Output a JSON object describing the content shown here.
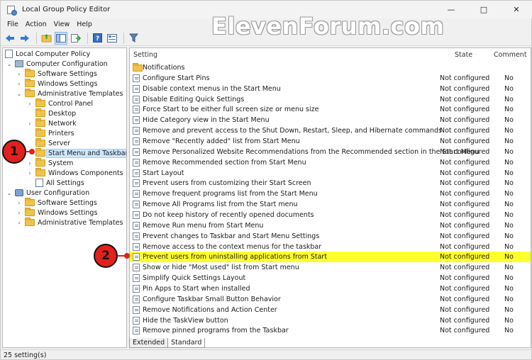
{
  "window": {
    "title": "Local Group Policy Editor",
    "controls": {
      "minimize": "—",
      "maximize": "□",
      "close": "✕"
    }
  },
  "watermark": "ElevenForum.com",
  "menu": {
    "file": "File",
    "action": "Action",
    "view": "View",
    "help": "Help"
  },
  "toolbar": {
    "icons": [
      "back-arrow-icon",
      "forward-arrow-icon",
      "folder-up-icon",
      "show-hide-tree-icon",
      "export-list-icon",
      "help-icon",
      "properties-icon",
      "filter-icon"
    ]
  },
  "tree": {
    "root": "Local Computer Policy",
    "computer_config": "Computer Configuration",
    "cc_software": "Software Settings",
    "cc_windows": "Windows Settings",
    "cc_admin": "Administrative Templates",
    "control_panel": "Control Panel",
    "desktop": "Desktop",
    "network": "Network",
    "printers": "Printers",
    "server": "Server",
    "start_menu": "Start Menu and Taskbar",
    "system": "System",
    "windows_components": "Windows Components",
    "all_settings": "All Settings",
    "user_config": "User Configuration",
    "uc_software": "Software Settings",
    "uc_windows": "Windows Settings",
    "uc_admin": "Administrative Templates"
  },
  "list": {
    "columns": {
      "setting": "Setting",
      "state": "State",
      "comment": "Comment"
    },
    "folder_row": "Notifications",
    "rows": [
      {
        "name": "Configure Start Pins",
        "state": "Not configured",
        "comment": "No"
      },
      {
        "name": "Disable context menus in the Start Menu",
        "state": "Not configured",
        "comment": "No"
      },
      {
        "name": "Disable Editing Quick Settings",
        "state": "Not configured",
        "comment": "No"
      },
      {
        "name": "Force Start to be either full screen size or menu size",
        "state": "Not configured",
        "comment": "No"
      },
      {
        "name": "Hide Category view in the Start Menu",
        "state": "Not configured",
        "comment": "No"
      },
      {
        "name": "Remove and prevent access to the Shut Down, Restart, Sleep, and Hibernate commands",
        "state": "Not configured",
        "comment": "No"
      },
      {
        "name": "Remove \"Recently added\" list from Start Menu",
        "state": "Not configured",
        "comment": "No"
      },
      {
        "name": "Remove Personalized Website Recommendations from the Recommended section in the Start Menu",
        "state": "Not configured",
        "comment": "No"
      },
      {
        "name": "Remove Recommended section from Start Menu",
        "state": "Not configured",
        "comment": "No"
      },
      {
        "name": "Start Layout",
        "state": "Not configured",
        "comment": "No"
      },
      {
        "name": "Prevent users from customizing their Start Screen",
        "state": "Not configured",
        "comment": "No"
      },
      {
        "name": "Remove frequent programs list from the Start Menu",
        "state": "Not configured",
        "comment": "No"
      },
      {
        "name": "Remove All Programs list from the Start menu",
        "state": "Not configured",
        "comment": "No"
      },
      {
        "name": "Do not keep history of recently opened documents",
        "state": "Not configured",
        "comment": "No"
      },
      {
        "name": "Remove Run menu from Start Menu",
        "state": "Not configured",
        "comment": "No"
      },
      {
        "name": "Prevent changes to Taskbar and Start Menu Settings",
        "state": "Not configured",
        "comment": "No"
      },
      {
        "name": "Remove access to the context menus for the taskbar",
        "state": "Not configured",
        "comment": "No"
      },
      {
        "name": "Prevent users from uninstalling applications from Start",
        "state": "Not configured",
        "comment": "No"
      },
      {
        "name": "Show or hide \"Most used\" list from Start menu",
        "state": "Not configured",
        "comment": "No"
      },
      {
        "name": "Simplify Quick Settings Layout",
        "state": "Not configured",
        "comment": "No"
      },
      {
        "name": "Pin Apps to Start when installed",
        "state": "Not configured",
        "comment": "No"
      },
      {
        "name": "Configure Taskbar Small Button Behavior",
        "state": "Not configured",
        "comment": "No"
      },
      {
        "name": "Remove Notifications and Action Center",
        "state": "Not configured",
        "comment": "No"
      },
      {
        "name": "Hide the TaskView button",
        "state": "Not configured",
        "comment": "No"
      },
      {
        "name": "Remove pinned programs from the Taskbar",
        "state": "Not configured",
        "comment": "No"
      }
    ]
  },
  "tabs": {
    "extended": "Extended",
    "standard": "Standard"
  },
  "status": "25 setting(s)",
  "callouts": {
    "one": "1",
    "two": "2"
  },
  "colors": {
    "highlight": "#ffff2e",
    "callout": "#e3201c",
    "selection": "#cce8ff"
  }
}
